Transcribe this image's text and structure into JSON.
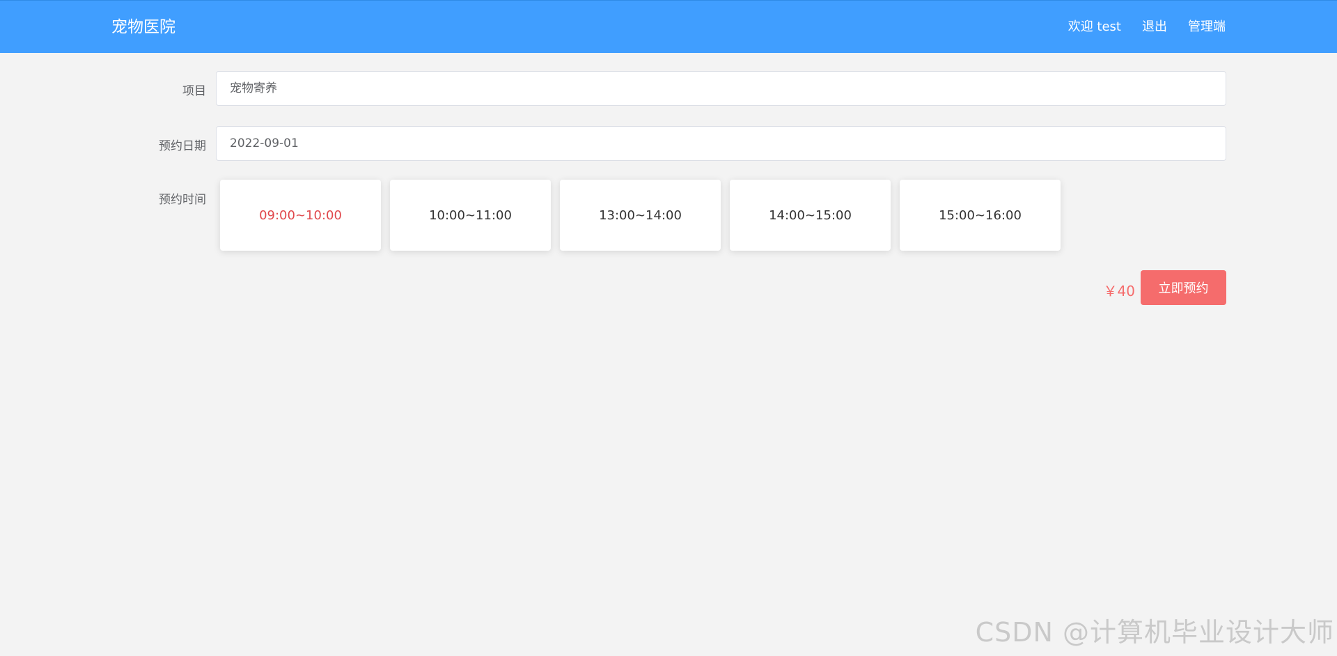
{
  "header": {
    "brand": "宠物医院",
    "nav": {
      "welcome": "欢迎 test",
      "logout": "退出",
      "admin": "管理端"
    }
  },
  "form": {
    "item_label": "项目",
    "item_value": "宠物寄养",
    "date_label": "预约日期",
    "date_value": "2022-09-01",
    "time_label": "预约时间",
    "time_slots": [
      {
        "label": "09:00~10:00",
        "selected": true
      },
      {
        "label": "10:00~11:00",
        "selected": false
      },
      {
        "label": "13:00~14:00",
        "selected": false
      },
      {
        "label": "14:00~15:00",
        "selected": false
      },
      {
        "label": "15:00~16:00",
        "selected": false
      }
    ]
  },
  "booking": {
    "price": "￥40",
    "button_label": "立即预约"
  },
  "watermark": "CSDN @计算机毕业设计大师",
  "colors": {
    "header_bg": "#409eff",
    "accent_red": "#f56c6c",
    "selected_text": "#e0484c"
  }
}
